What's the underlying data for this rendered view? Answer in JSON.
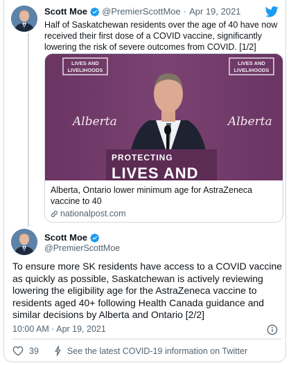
{
  "parent_tweet": {
    "name": "Scott Moe",
    "handle": "@PremierScottMoe",
    "separator": "·",
    "date": "Apr 19, 2021",
    "text": "Half of Saskatchewan residents over the age of 40 have now received their first dose of a COVID vaccine, significantly lowering the risk of severe outcomes from COVID. [1/2]",
    "card": {
      "image_signs": [
        "LIVES AND",
        "LIVELIHOODS"
      ],
      "image_brand": "Alberta",
      "image_banner_line1": "PROTECTING",
      "image_banner_line2": "LIVES AND",
      "title": "Alberta, Ontario lower minimum age for AstraZeneca vaccine to 40",
      "domain": "nationalpost.com"
    }
  },
  "main_tweet": {
    "name": "Scott Moe",
    "handle": "@PremierScottMoe",
    "text": "To ensure more SK residents have access to a COVID vaccine as quickly as possible, Saskatchewan is actively reviewing lowering the eligibility age for the AstraZeneca vaccine to residents aged 40+ following Health Canada guidance and similar decisions by Alberta and Ontario [2/2]",
    "timestamp": "10:00 AM · Apr 19, 2021",
    "likes": "39",
    "covid_info": "See the latest COVID-19 information on Twitter"
  },
  "colors": {
    "twitter_blue": "#1d9bf0",
    "muted_text": "#536471",
    "border": "#cfd9de",
    "card_purple": "#6d3a66"
  },
  "icons": [
    "verified-badge-icon",
    "twitter-bird-icon",
    "link-icon",
    "info-icon",
    "heart-icon",
    "lightning-icon"
  ]
}
